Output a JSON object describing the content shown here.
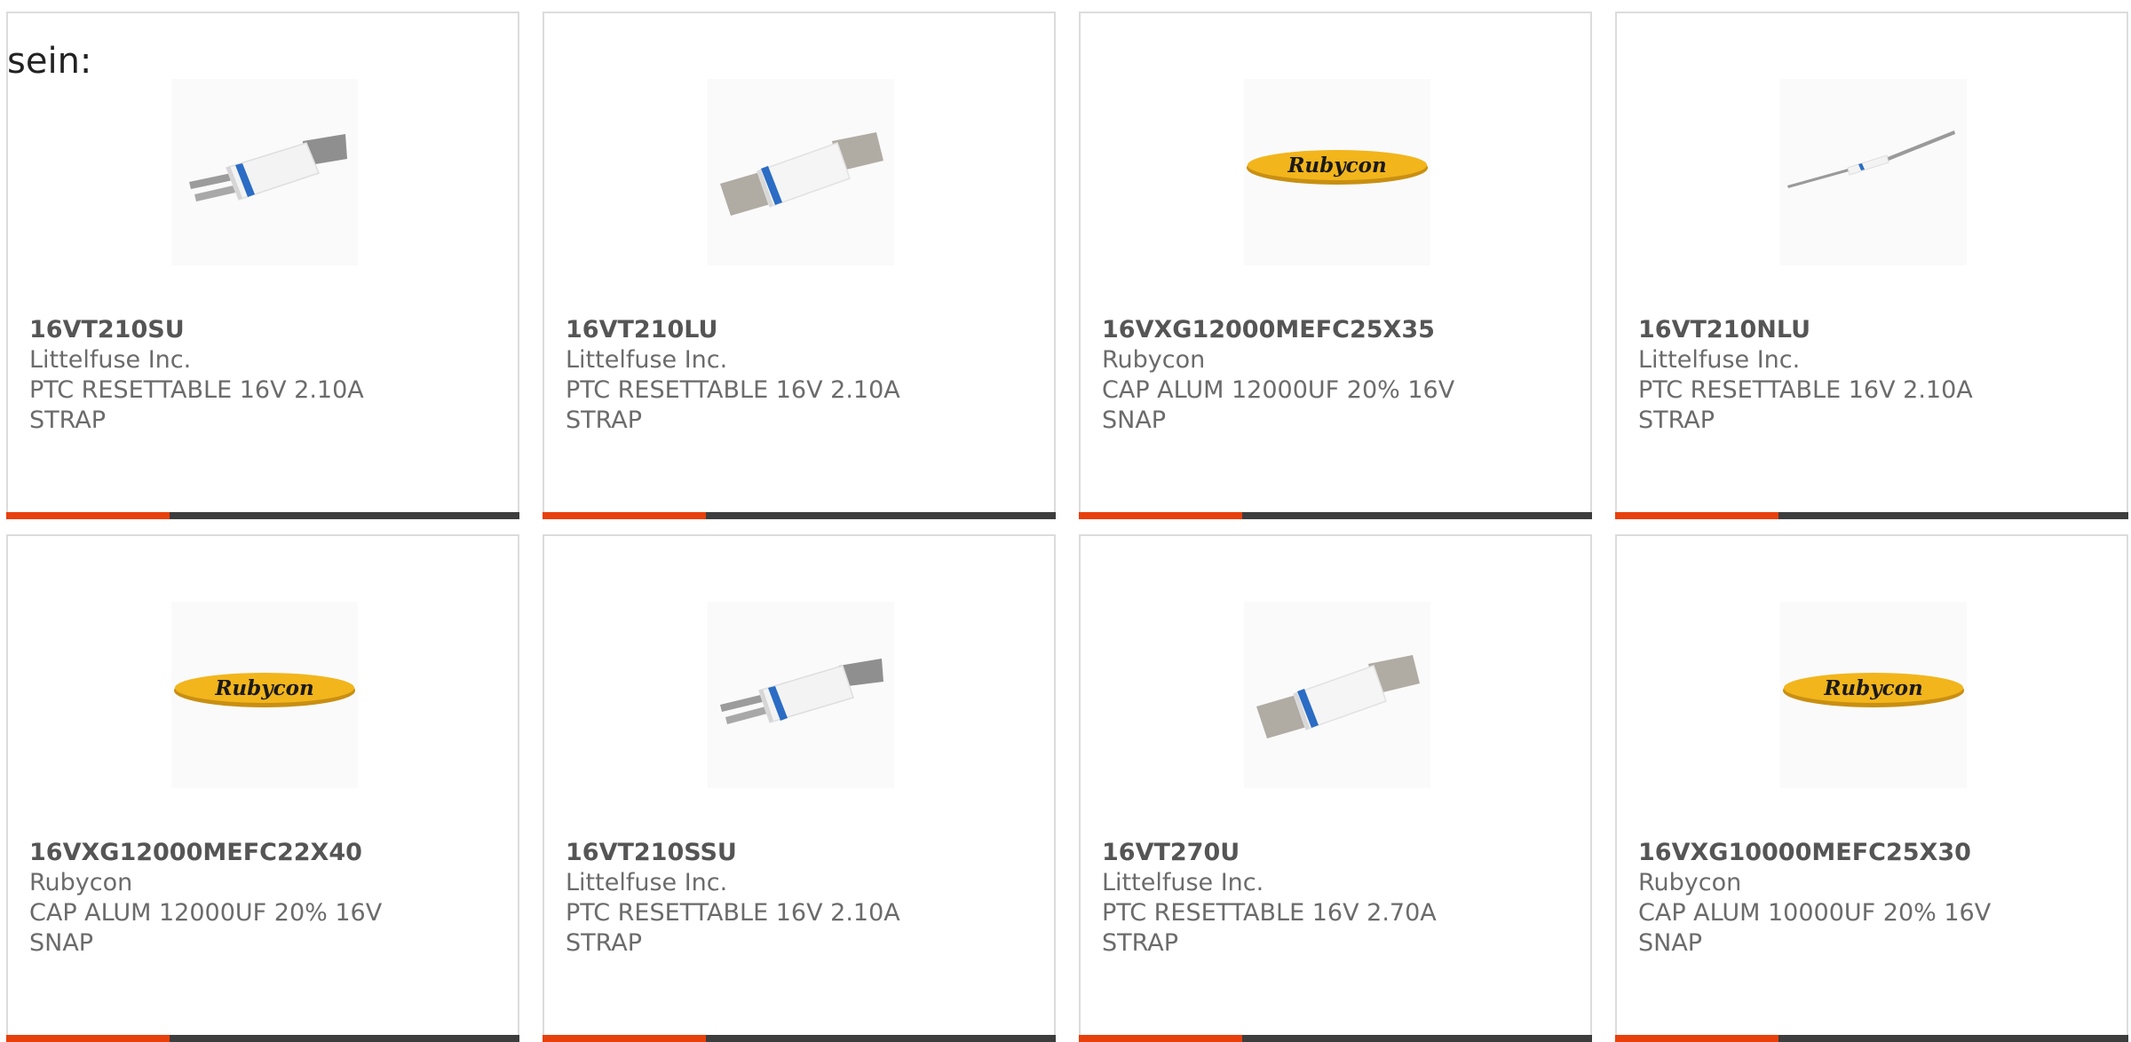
{
  "intro_text": "sein:",
  "colors": {
    "accent": "#e8400c",
    "bar_dark": "#3d3d3d",
    "rubycon_yellow": "#f2b51c",
    "strip_blue": "#2b6cc4"
  },
  "products": [
    {
      "part": "16VT210SU",
      "maker": "Littelfuse Inc.",
      "desc1": "PTC RESETTABLE 16V 2.10A",
      "desc2": "STRAP",
      "image": "ptc-strap-fuse"
    },
    {
      "part": "16VT210LU",
      "maker": "Littelfuse Inc.",
      "desc1": "PTC RESETTABLE 16V 2.10A",
      "desc2": "STRAP",
      "image": "ptc-strap-fuse-long"
    },
    {
      "part": "16VXG12000MEFC25X35",
      "maker": "Rubycon",
      "desc1": "CAP ALUM 12000UF 20% 16V",
      "desc2": "SNAP",
      "image": "rubycon-logo",
      "logo_text": "Rubycon"
    },
    {
      "part": "16VT210NLU",
      "maker": "Littelfuse Inc.",
      "desc1": "PTC RESETTABLE 16V 2.10A",
      "desc2": "STRAP",
      "image": "ptc-strap-fuse-narrow"
    },
    {
      "part": "16VXG12000MEFC22X40",
      "maker": "Rubycon",
      "desc1": "CAP ALUM 12000UF 20% 16V",
      "desc2": "SNAP",
      "image": "rubycon-logo",
      "logo_text": "Rubycon"
    },
    {
      "part": "16VT210SSU",
      "maker": "Littelfuse Inc.",
      "desc1": "PTC RESETTABLE 16V 2.10A",
      "desc2": "STRAP",
      "image": "ptc-strap-fuse"
    },
    {
      "part": "16VT270U",
      "maker": "Littelfuse Inc.",
      "desc1": "PTC RESETTABLE 16V 2.70A",
      "desc2": "STRAP",
      "image": "ptc-strap-fuse-long"
    },
    {
      "part": "16VXG10000MEFC25X30",
      "maker": "Rubycon",
      "desc1": "CAP ALUM 10000UF 20% 16V",
      "desc2": "SNAP",
      "image": "rubycon-logo",
      "logo_text": "Rubycon"
    }
  ]
}
